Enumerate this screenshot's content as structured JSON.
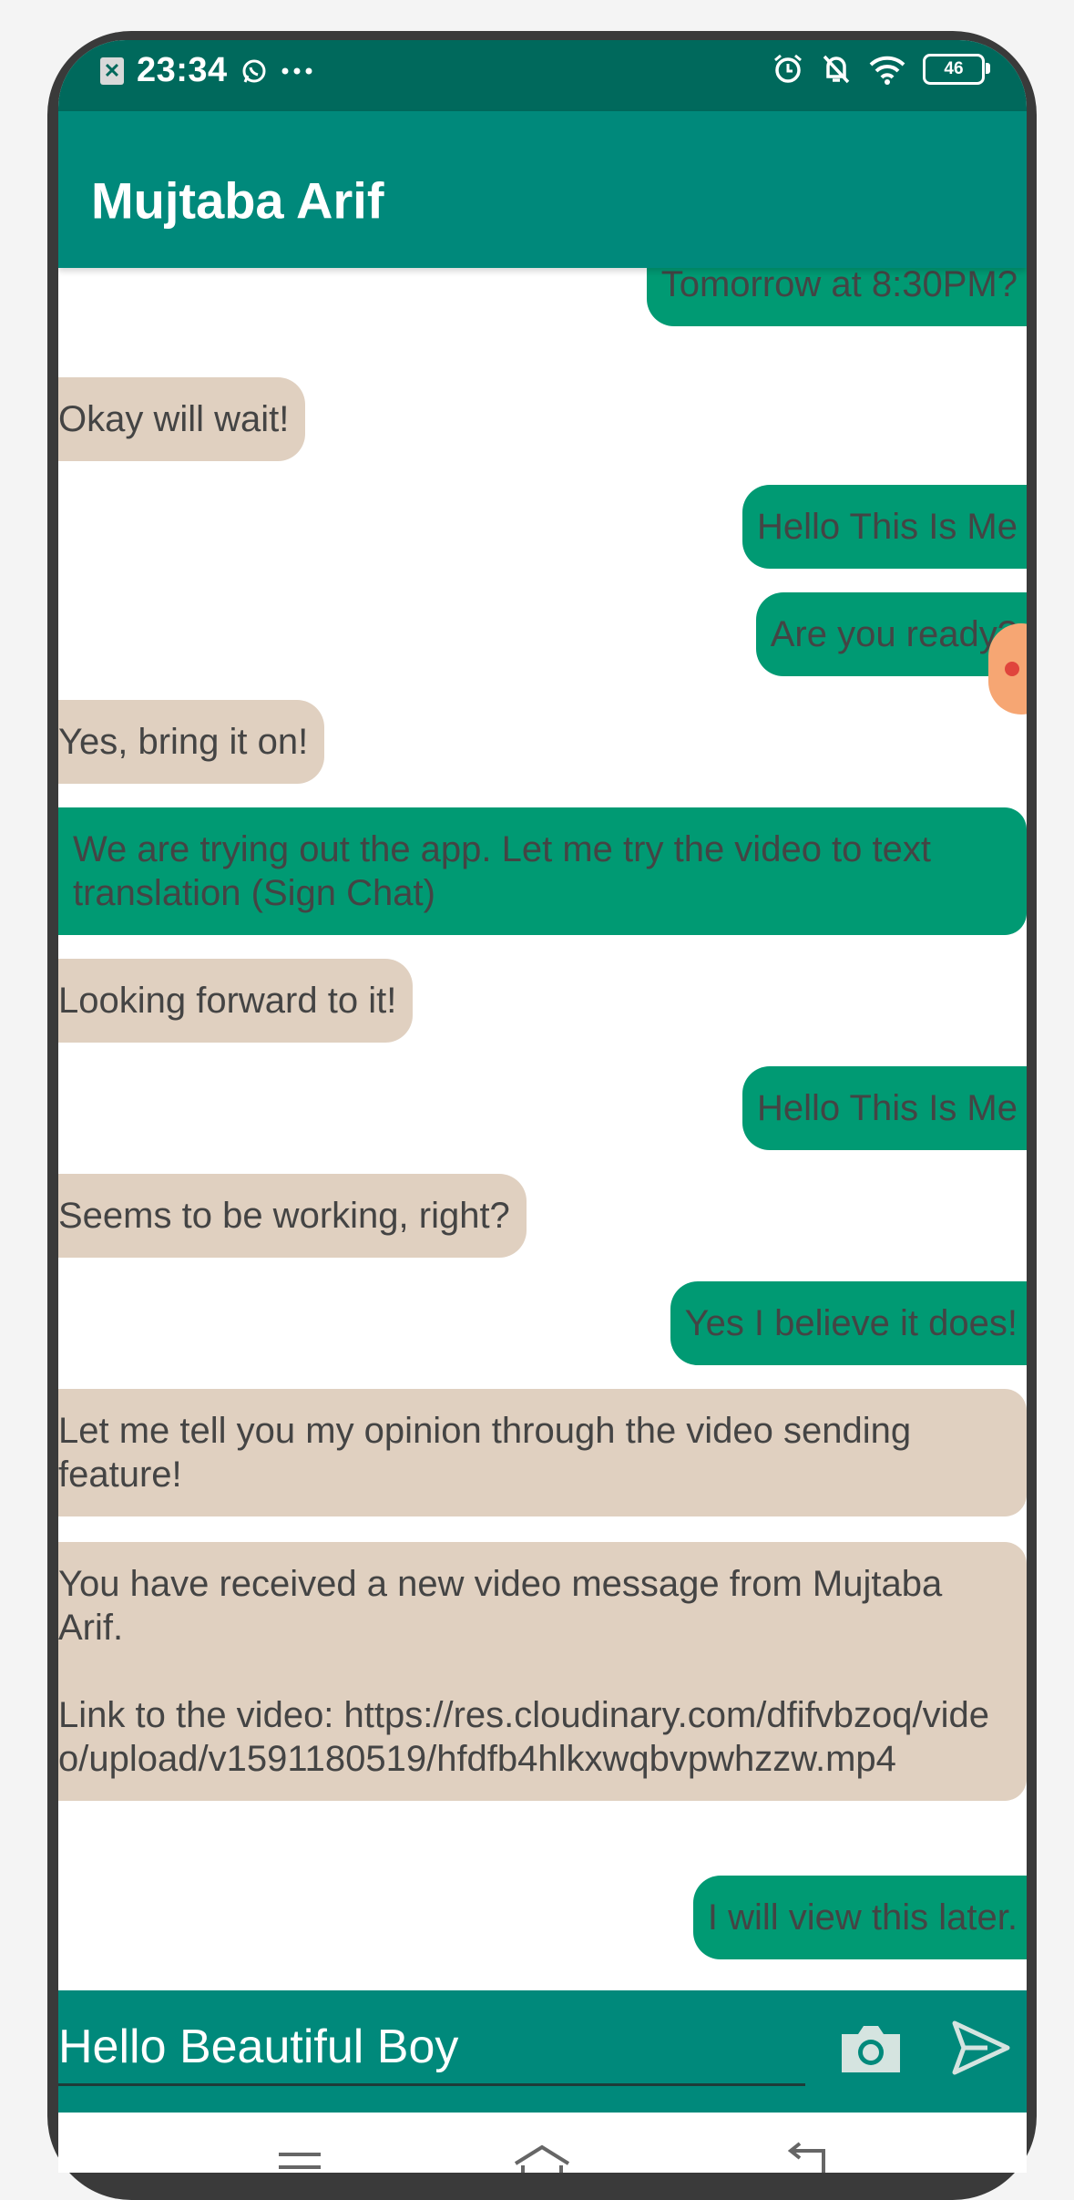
{
  "status_bar": {
    "time": "23:34",
    "battery": "46",
    "left_icons": [
      "notification-x-icon",
      "whatsapp-icon",
      "more-dots-icon"
    ],
    "right_icons": [
      "alarm-icon",
      "bell-muted-icon",
      "wifi-icon",
      "battery-icon"
    ]
  },
  "header": {
    "title": "Mujtaba Arif"
  },
  "messages": [
    {
      "side": "sent",
      "text": "Tomorrow at 8:30PM?"
    },
    {
      "side": "received",
      "text": "Okay will wait!"
    },
    {
      "side": "sent",
      "text": "Hello This Is Me"
    },
    {
      "side": "sent",
      "text": "Are you ready?"
    },
    {
      "side": "received",
      "text": "Yes, bring it on!"
    },
    {
      "side": "sent",
      "text": "We are trying out the app. Let me try the video to text translation (Sign Chat)"
    },
    {
      "side": "received",
      "text": "Looking forward to it!"
    },
    {
      "side": "sent",
      "text": "Hello This Is Me"
    },
    {
      "side": "received",
      "text": "Seems to be working, right?"
    },
    {
      "side": "sent",
      "text": "Yes I believe it does!"
    },
    {
      "side": "received",
      "text": "Let me tell you my opinion through the video sending feature!"
    },
    {
      "side": "received",
      "text": "You have received a new video message from Mujtaba Arif.",
      "link_line": "Link to the video: https://res.cloudinary.com/dfifvbzoq/video/upload/v1591180519/hfdfb4hlkxwqbvpwhzzw.mp4"
    },
    {
      "side": "sent",
      "text": "I will view this later."
    }
  ],
  "composer": {
    "value": "Hello Beautiful Boy",
    "camera_icon": "camera-icon",
    "send_icon": "send-icon"
  },
  "nav": {
    "icons": [
      "menu-icon",
      "home-icon",
      "back-icon"
    ]
  },
  "colors": {
    "status_bar": "#00695c",
    "app_bar": "#00897b",
    "sent_bubble": "#009a73",
    "received_bubble": "#e0d0c0",
    "text": "#444444"
  }
}
